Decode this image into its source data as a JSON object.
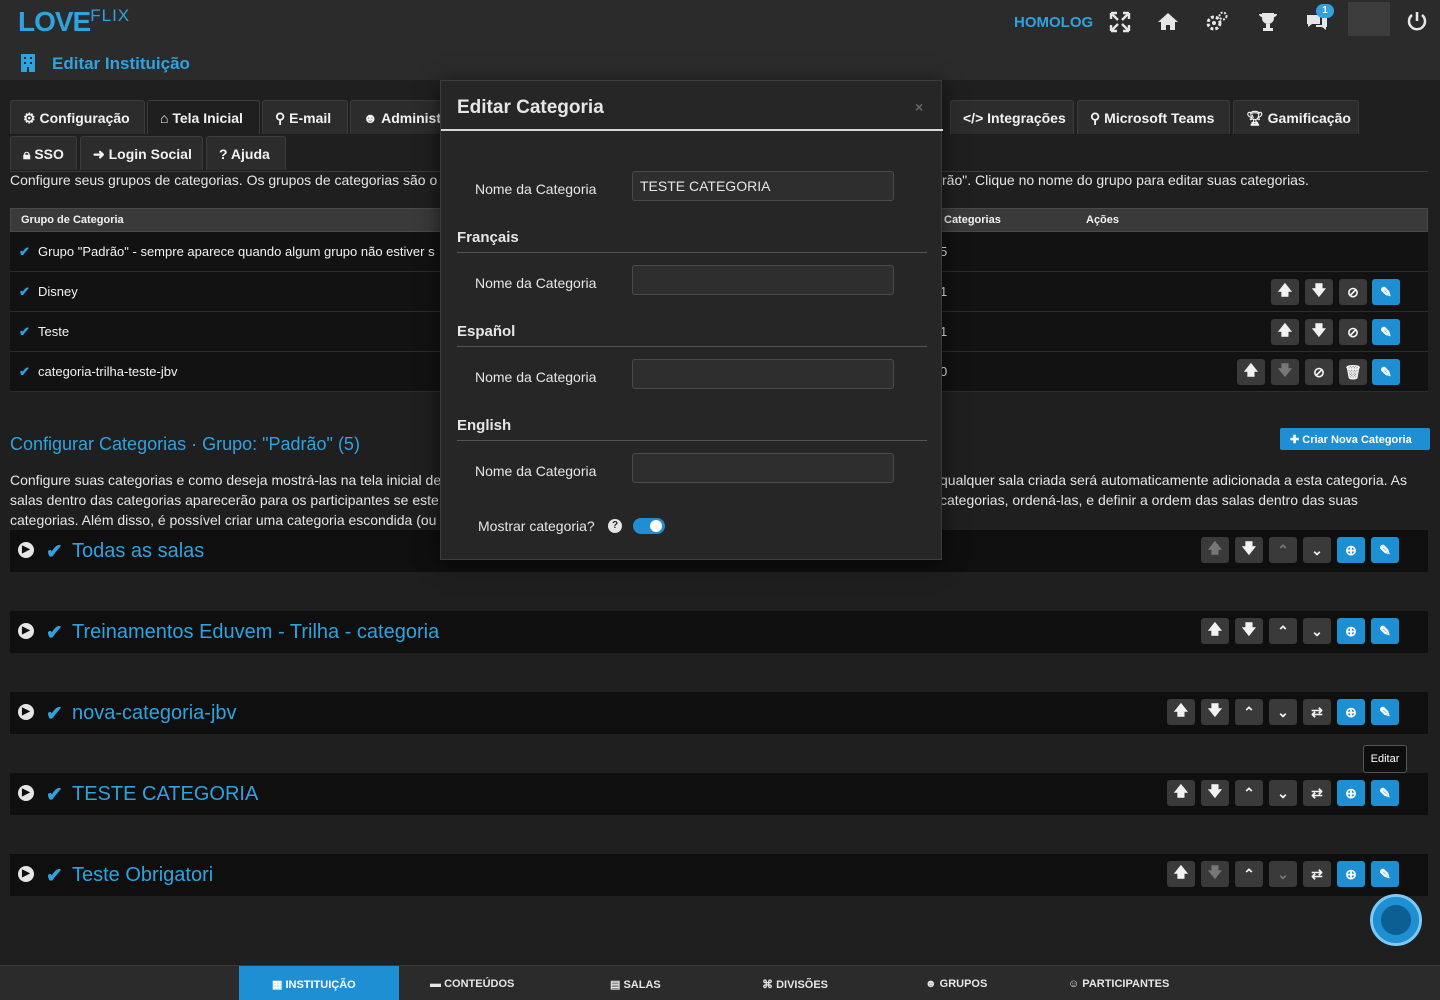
{
  "header": {
    "logo_love": "LOVE",
    "logo_flix": "FLIX",
    "environment": "HOMOLOG",
    "notification_count": "1",
    "page_title": "Editar Instituição"
  },
  "tabs": [
    {
      "label": "Configuração",
      "icon": "cogs-icon"
    },
    {
      "label": "Tela Inicial",
      "icon": "home-icon"
    },
    {
      "label": "E-mail",
      "icon": "link-icon"
    },
    {
      "label": "Administ",
      "icon": "users-icon"
    },
    {
      "label": "Integrações",
      "icon": "code-icon"
    },
    {
      "label": "Microsoft Teams",
      "icon": "link-icon"
    },
    {
      "label": "Gamificação",
      "icon": "trophy-icon"
    },
    {
      "label": "SSO",
      "icon": "lock-icon"
    },
    {
      "label": "Login Social",
      "icon": "sign-in-icon"
    },
    {
      "label": "Ajuda",
      "icon": "question-icon"
    }
  ],
  "intro": {
    "left": "Configure seus grupos de categorias. Os grupos de categorias são o",
    "right": "rão\". Clique no nome do grupo para editar suas categorias."
  },
  "group_table": {
    "col_group": "Grupo de Categoria",
    "col_categories": "Categorias",
    "col_actions": "Ações",
    "rows": [
      {
        "name": "Grupo \"Padrão\" - sempre aparece quando algum grupo não estiver s",
        "count": "5"
      },
      {
        "name": "Disney",
        "count": "1"
      },
      {
        "name": "Teste",
        "count": "1"
      },
      {
        "name": "categoria-trilha-teste-jbv",
        "count": "0"
      }
    ]
  },
  "categories_section": {
    "title": "Configurar Categorias · Grupo: \"Padrão\" (5)",
    "new_button": "Criar Nova Categoria",
    "para_left_1": "Configure suas categorias e como deseja mostrá-las na tela inicial de",
    "para_left_2": "salas dentro das categorias aparecerão para os participantes se este",
    "para_left_3": "categorias. Além disso, é possível criar uma categoria escondida (ou",
    "para_right_1": "qualquer sala criada será automaticamente adicionada a esta categoria. As",
    "para_right_2": "categorias, ordená-las, e definir a ordem das salas dentro das suas",
    "rows": [
      {
        "name": "Todas as salas"
      },
      {
        "name": "Treinamentos Eduvem - Trilha - categoria"
      },
      {
        "name": "nova-categoria-jbv"
      },
      {
        "name": "TESTE CATEGORIA"
      },
      {
        "name": "Teste Obrigatori"
      }
    ],
    "tooltip": "Editar"
  },
  "modal": {
    "title": "Editar Categoria",
    "close": "×",
    "name_label": "Nome da Categoria",
    "name_value": "TESTE CATEGORIA",
    "languages": [
      {
        "lang": "Français",
        "label": "Nome da Categoria",
        "value": ""
      },
      {
        "lang": "Español",
        "label": "Nome da Categoria",
        "value": ""
      },
      {
        "lang": "English",
        "label": "Nome da Categoria",
        "value": ""
      }
    ],
    "show_label": "Mostrar categoria?",
    "show_value": "on"
  },
  "bottom_nav": [
    {
      "label": "INSTITUIÇÃO",
      "icon": "building-icon",
      "active": true
    },
    {
      "label": "CONTEÚDOS",
      "icon": "folder-icon"
    },
    {
      "label": "SALAS",
      "icon": "book-icon"
    },
    {
      "label": "DIVISÕES",
      "icon": "sitemap-icon"
    },
    {
      "label": "GRUPOS",
      "icon": "users-icon"
    },
    {
      "label": "PARTICIPANTES",
      "icon": "user-icon"
    }
  ],
  "colors": {
    "accent": "#2fa3e0",
    "button_blue": "#1e8fd3",
    "background": "#1f1f1f"
  }
}
